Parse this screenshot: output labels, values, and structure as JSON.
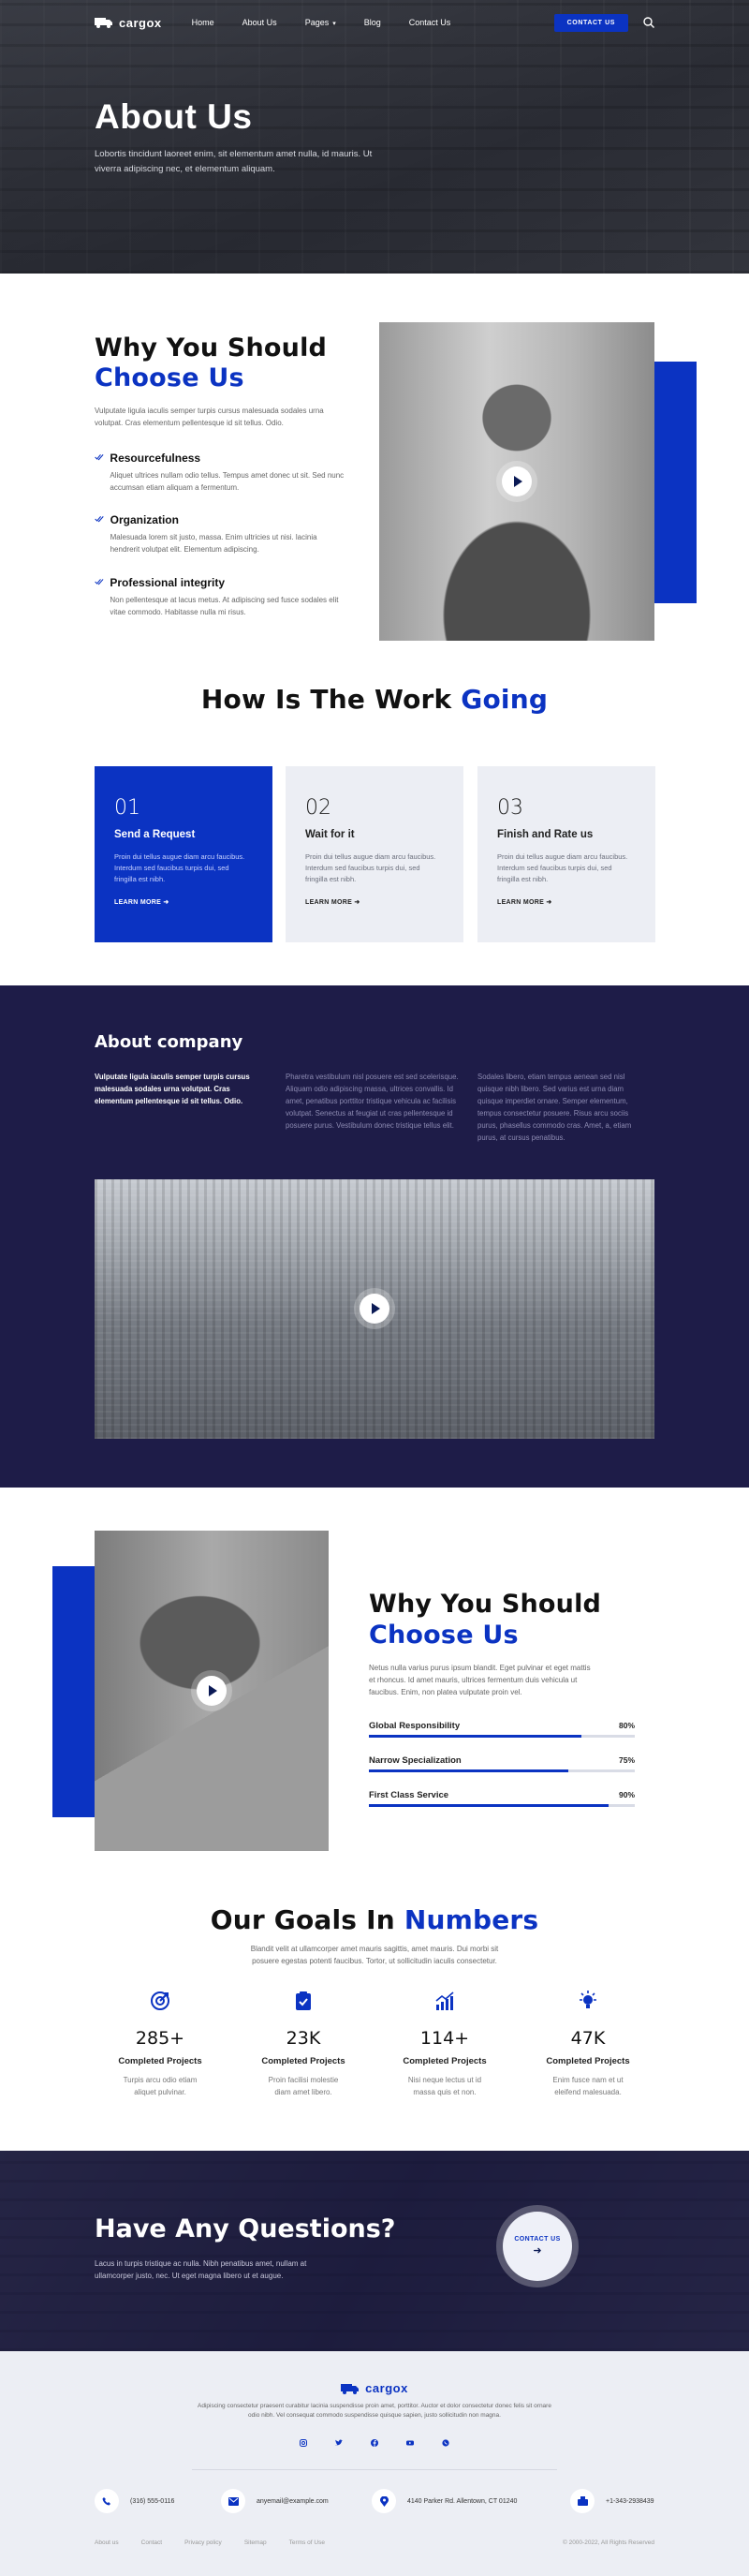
{
  "nav": {
    "logo": "cargox",
    "links": [
      "Home",
      "About Us",
      "Pages",
      "Blog",
      "Contact Us"
    ],
    "cta": "CONTACT US"
  },
  "hero": {
    "title": "About Us",
    "subtitle": "Lobortis tincidunt laoreet enim, sit elementum amet nulla, id mauris. Ut viverra adipiscing nec, et elementum aliquam."
  },
  "why1": {
    "title_a": "Why You Should",
    "title_b": "Choose Us",
    "intro": "Vulputate ligula iaculis semper turpis cursus malesuada sodales urna volutpat. Cras elementum pellentesque id sit tellus. Odio.",
    "features": [
      {
        "title": "Resourcefulness",
        "text": "Aliquet ultrices nullam odio tellus. Tempus amet donec ut sit. Sed nunc accumsan etiam aliquam a fermentum."
      },
      {
        "title": "Organization",
        "text": "Malesuada lorem sit justo, massa. Enim ultricies ut nisi. lacinia hendrerit volutpat elit. Elementum adipiscing."
      },
      {
        "title": "Professional integrity",
        "text": "Non pellentesque at lacus metus. At adipiscing sed fusce sodales elit vitae commodo. Habitasse nulla mi risus."
      }
    ]
  },
  "work": {
    "title_a": "How Is The Work",
    "title_b": "Going",
    "cards": [
      {
        "num": "01",
        "title": "Send a Request",
        "text": "Proin dui tellus augue diam arcu faucibus. Interdum sed faucibus turpis dui, sed fringilla est nibh.",
        "link": "LEARN MORE"
      },
      {
        "num": "02",
        "title": "Wait for it",
        "text": "Proin dui tellus augue diam arcu faucibus. Interdum sed faucibus turpis dui, sed fringilla est nibh.",
        "link": "LEARN MORE"
      },
      {
        "num": "03",
        "title": "Finish and Rate us",
        "text": "Proin dui tellus augue diam arcu faucibus. Interdum sed faucibus turpis dui, sed fringilla est nibh.",
        "link": "LEARN MORE"
      }
    ]
  },
  "company": {
    "title": "About company",
    "lead": "Vulputate ligula iaculis semper turpis cursus malesuada sodales urna volutpat. Cras elementum pellentesque id sit tellus. Odio.",
    "col2": "Pharetra vestibulum nisl posuere est sed scelerisque. Aliquam odio adipiscing massa, ultrices convallis. Id amet, penatibus porttitor tristique vehicula ac facilisis volutpat. Senectus at feugiat ut cras pellentesque id posuere purus. Vestibulum donec tristique tellus elit.",
    "col3": "Sodales libero, etiam tempus aenean sed nisl quisque nibh libero. Sed varius est urna diam quisque imperdiet ornare. Semper elementum, tempus consectetur posuere. Risus arcu sociis purus, phasellus commodo cras. Amet, a, etiam purus, at cursus penatibus."
  },
  "why2": {
    "title_a": "Why You Should",
    "title_b": "Choose Us",
    "text": "Netus nulla varius purus ipsum blandit. Eget pulvinar et eget mattis et rhoncus. Id amet mauris, ultrices fermentum duis vehicula ut faucibus. Enim, non platea vulputate proin vel.",
    "skills": [
      {
        "label": "Global Responsibility",
        "value": "80%",
        "percent": 80
      },
      {
        "label": "Narrow Specialization",
        "value": "75%",
        "percent": 75
      },
      {
        "label": "First Class Service",
        "value": "90%",
        "percent": 90
      }
    ]
  },
  "goals": {
    "title_a": "Our Goals In",
    "title_b": "Numbers",
    "intro": "Blandit velit at ullamcorper amet mauris sagittis, amet mauris. Dui morbi sit posuere egestas potenti faucibus. Tortor, ut sollicitudin iaculis consectetur.",
    "stats": [
      {
        "icon": "target-icon",
        "value": "285+",
        "label": "Completed Projects",
        "text": "Turpis arcu odio etiam aliquet pulvinar."
      },
      {
        "icon": "clipboard-check-icon",
        "value": "23K",
        "label": "Completed Projects",
        "text": "Proin facilisi molestie diam amet libero."
      },
      {
        "icon": "growth-chart-icon",
        "value": "114+",
        "label": "Completed Projects",
        "text": "Nisi neque lectus ut id massa quis et non."
      },
      {
        "icon": "lightbulb-icon",
        "value": "47K",
        "label": "Completed Projects",
        "text": "Enim fusce nam et ut eleifend malesuada."
      }
    ]
  },
  "cta": {
    "title": "Have Any Questions?",
    "text": "Lacus in turpis tristique ac nulla. Nibh penatibus amet, nullam at ullamcorper justo, nec. Ut eget magna libero ut et augue.",
    "button": "CONTACT US"
  },
  "footer": {
    "logo": "cargox",
    "text": "Adipiscing consectetur praesent curabitur lacinia suspendisse proin amet, porttitor. Auctor et dolor consectetur donec felis sit ornare odio nibh. Vel consequat commodo suspendisse quisque sapien, justo sollicitudin non magna.",
    "contacts": [
      {
        "icon": "phone-icon",
        "text": "(316) 555-0116"
      },
      {
        "icon": "mail-icon",
        "text": "anyemail@example.com"
      },
      {
        "icon": "location-icon",
        "text": "4140 Parker Rd. Allentown, CT 01240"
      },
      {
        "icon": "fax-icon",
        "text": "+1-343-2938439"
      }
    ],
    "links": [
      "About us",
      "Contact",
      "Privacy policy",
      "Sitemap",
      "Terms of Use"
    ],
    "copyright": "© 2000-2022, All Rights Reserved"
  },
  "colors": {
    "accent": "#0b33c2",
    "dark": "#1e1c48",
    "light_bg": "#eceef4"
  }
}
